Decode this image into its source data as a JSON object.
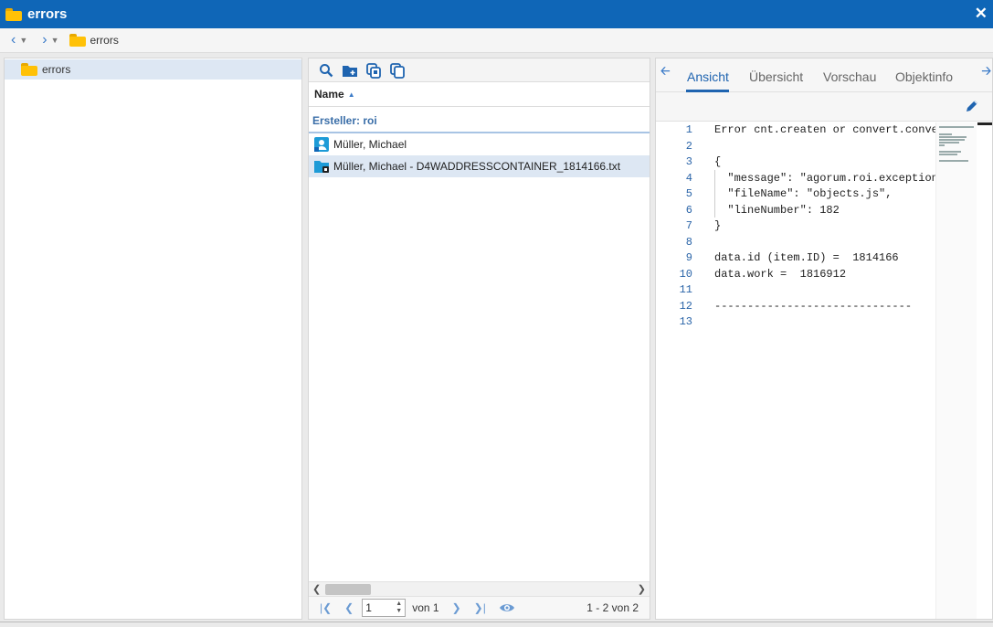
{
  "window": {
    "title": "errors",
    "close_label": "✕"
  },
  "nav": {
    "breadcrumb_label": "errors"
  },
  "tree": {
    "items": [
      {
        "label": "errors",
        "icon": "folder-icon"
      }
    ]
  },
  "list": {
    "column_header": "Name",
    "sort": "ascending",
    "group_label": "Ersteller: roi",
    "rows": [
      {
        "label": "Müller, Michael",
        "icon": "user-card-icon"
      },
      {
        "label": "Müller, Michael - D4WADDRESSCONTAINER_1814166.txt",
        "icon": "container-folder-icon"
      }
    ]
  },
  "pager": {
    "page_value": "1",
    "of_label": "von 1",
    "range_label": "1 - 2 von 2"
  },
  "preview": {
    "tabs": [
      "Ansicht",
      "Übersicht",
      "Vorschau",
      "Objektinfo"
    ],
    "active_tab": "Ansicht",
    "line_numbers": [
      "1",
      "2",
      "3",
      "4",
      "5",
      "6",
      "7",
      "8",
      "9",
      "10",
      "11",
      "12",
      "13"
    ],
    "code_lines": [
      "Error cnt.createn or convert.conver",
      "",
      "{",
      "  \"message\": \"agorum.roi.exception.",
      "  \"fileName\": \"objects.js\",",
      "  \"lineNumber\": 182",
      "}",
      "",
      "data.id (item.ID) =  1814166",
      "data.work =  1816912",
      "",
      "------------------------------",
      ""
    ]
  },
  "colors": {
    "titlebar": "#0f66b7",
    "accent": "#1f64b0",
    "selection": "#dde7f3",
    "folder": "#ffc107"
  }
}
